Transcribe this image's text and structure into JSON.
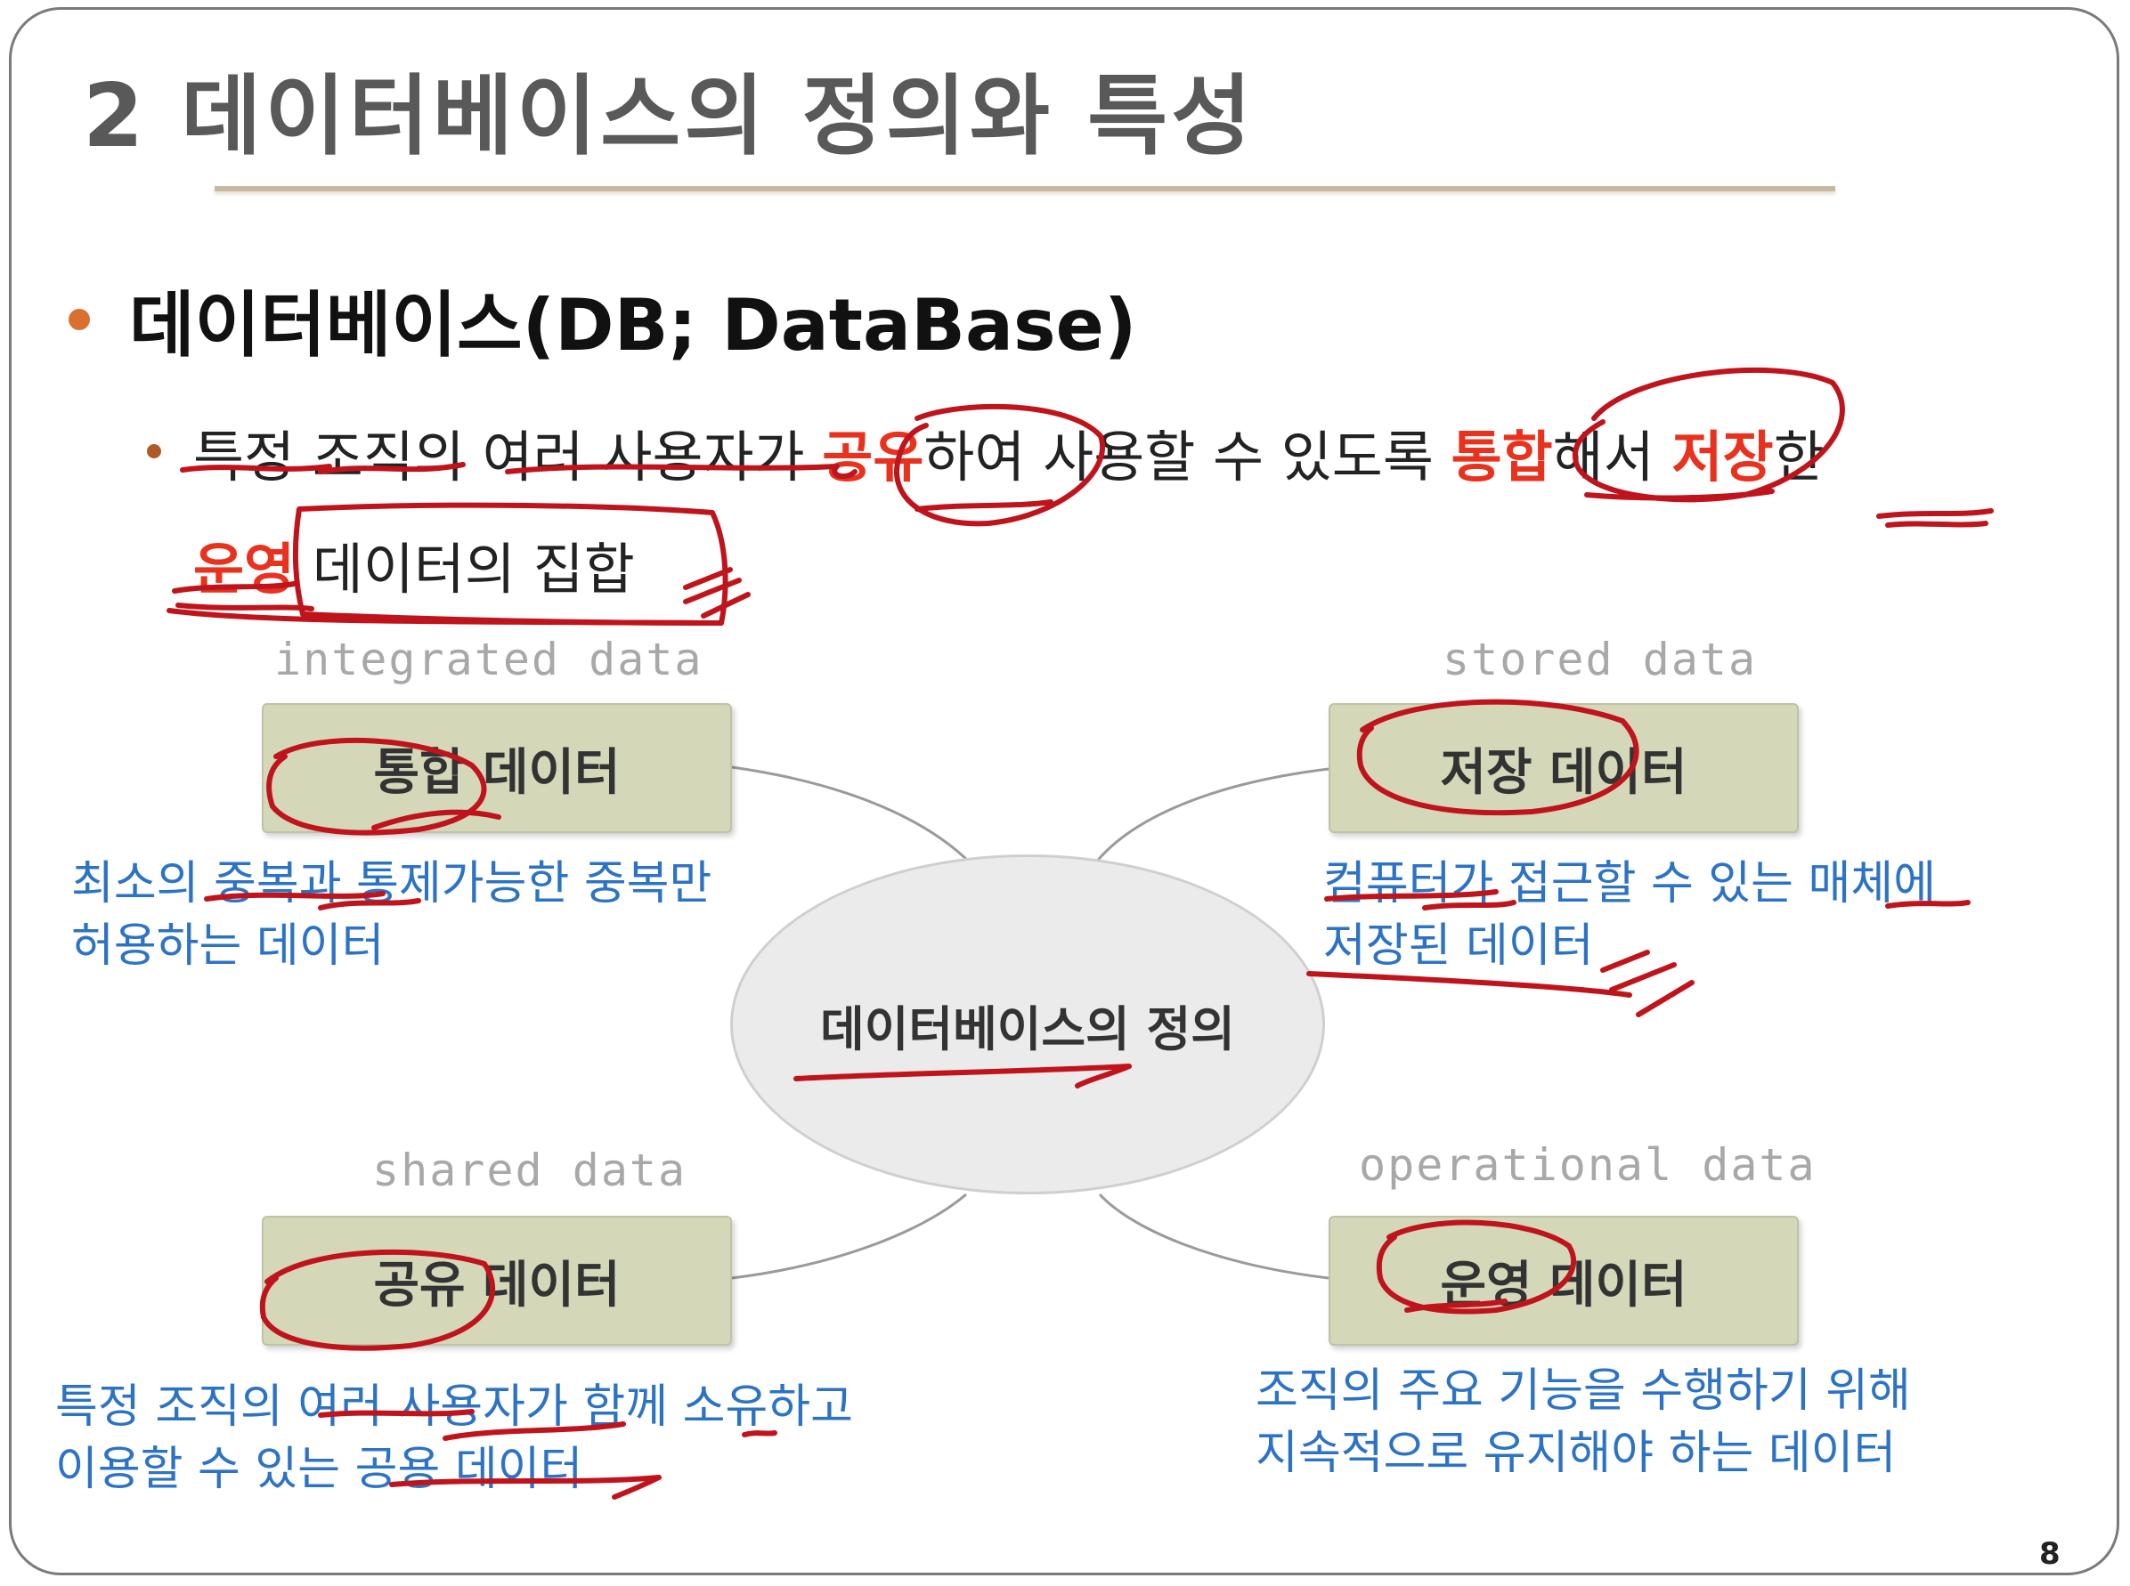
{
  "slide": {
    "title": "2 데이터베이스의 정의와 특성",
    "heading": "데이터베이스(DB; DataBase)",
    "definition": {
      "p1": "특정 조직의 여러 사용자가 ",
      "red1": "공유",
      "p2": "하여 사용할 수 있도록 ",
      "red2": "통합",
      "p3": "해서 ",
      "red3": "저장",
      "p4": "한",
      "red4": "운영",
      "p5": " 데이터의 집합"
    },
    "center_label": "데이터베이스의 정의",
    "integrated": {
      "english": "integrated data",
      "label": "통합 데이터",
      "desc1": "최소의 중복과 통제가능한 중복만",
      "desc2": "허용하는 데이터"
    },
    "stored": {
      "english": "stored data",
      "label": "저장 데이터",
      "desc1": "컴퓨터가 접근할 수 있는 매체에",
      "desc2": "저장된 데이터"
    },
    "shared": {
      "english": "shared data",
      "label": "공유 데이터",
      "desc1": "특정 조직의 여러 사용자가 함께 소유하고",
      "desc2": "이용할 수 있는 공용 데이터"
    },
    "operational": {
      "english": "operational data",
      "label": "운영 데이터",
      "desc1": "조직의 주요 기능을 수행하기 위해",
      "desc2": "지속적으로 유지해야 하는 데이터"
    },
    "page_number": "8"
  },
  "colors": {
    "accent_red": "#e8321e",
    "desc_blue": "#2d73c4",
    "box_fill": "#d4d8b9",
    "ink_red": "#c0141c",
    "bullet_orange": "#d9702e"
  }
}
